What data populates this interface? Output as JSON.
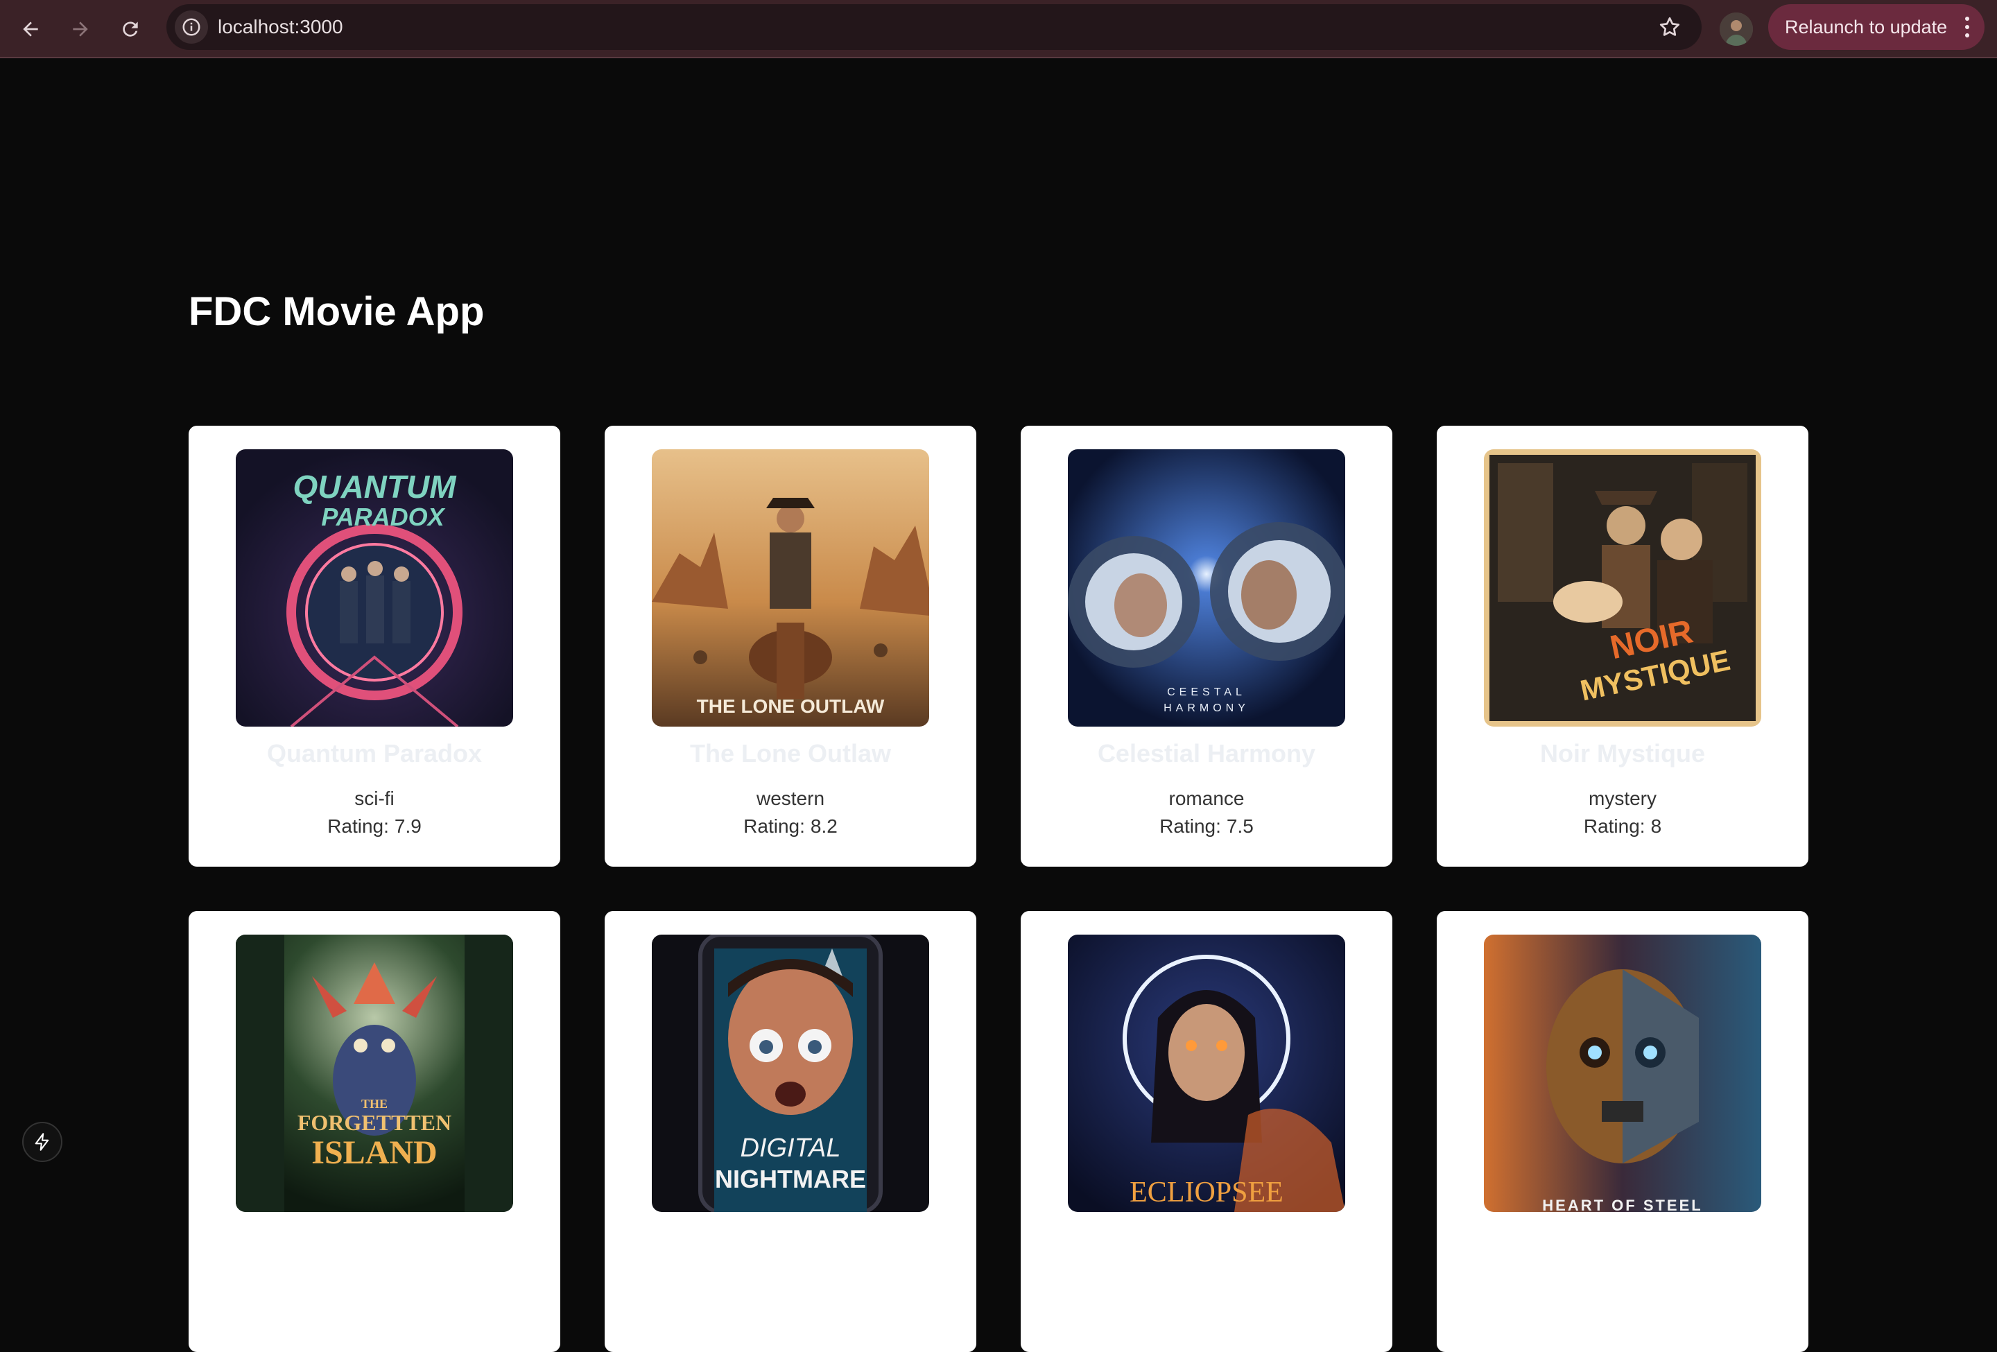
{
  "browser": {
    "url": "localhost:3000",
    "relaunch_label": "Relaunch to update",
    "icons": {
      "back": "arrow-left-icon",
      "forward": "arrow-right-icon",
      "reload": "reload-icon",
      "site_info": "info-icon",
      "bookmark": "star-icon",
      "menu": "kebab-menu-icon"
    }
  },
  "page": {
    "title": "FDC Movie App",
    "rating_prefix": "Rating:"
  },
  "movies": [
    {
      "title": "Quantum Paradox",
      "genre": "sci-fi",
      "rating": "7.9",
      "poster_text": [
        "QUANTUM",
        "PARADOX"
      ]
    },
    {
      "title": "The Lone Outlaw",
      "genre": "western",
      "rating": "8.2",
      "poster_text": [
        "THE LONE OUTLAW"
      ]
    },
    {
      "title": "Celestial Harmony",
      "genre": "romance",
      "rating": "7.5",
      "poster_text": [
        "CEESTAL",
        "HARMONY"
      ]
    },
    {
      "title": "Noir Mystique",
      "genre": "mystery",
      "rating": "8",
      "poster_text": [
        "NOIR",
        "MYSTIQUE"
      ]
    },
    {
      "title": "",
      "genre": "",
      "rating": "",
      "poster_text": [
        "THE",
        "FORGETTTEN",
        "ISLAND"
      ]
    },
    {
      "title": "",
      "genre": "",
      "rating": "",
      "poster_text": [
        "DIGITAL",
        "NIGHTMARE"
      ]
    },
    {
      "title": "",
      "genre": "",
      "rating": "",
      "poster_text": [
        "ECLIOPSEE"
      ]
    },
    {
      "title": "",
      "genre": "",
      "rating": "",
      "poster_text": [
        "HEART OF STEEL"
      ]
    }
  ],
  "colors": {
    "page_bg": "#0a0a0a",
    "toolbar_bg": "#3b2227",
    "relaunch_bg": "#6b2a3e",
    "card_bg": "#ffffff",
    "card_title": "#eceff3",
    "card_text": "#333333"
  }
}
